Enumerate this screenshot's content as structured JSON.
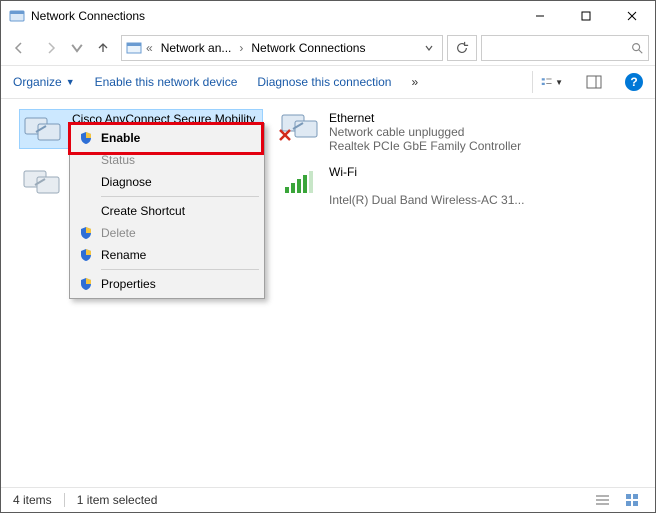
{
  "title": "Network Connections",
  "breadcrumb": {
    "lv1": "Network an...",
    "lv2": "Network Connections"
  },
  "commandbar": {
    "organize": "Organize",
    "enable_device": "Enable this network device",
    "diagnose": "Diagnose this connection"
  },
  "adapters": {
    "cisco": {
      "name": "Cisco AnyConnect Secure Mobility"
    },
    "ethernet": {
      "name": "Ethernet",
      "status": "Network cable unplugged",
      "device": "Realtek PCIe GbE Family Controller"
    },
    "wifi": {
      "name": "Wi-Fi",
      "device": "Intel(R) Dual Band Wireless-AC 31..."
    }
  },
  "context_menu": {
    "enable": "Enable",
    "status": "Status",
    "diagnose": "Diagnose",
    "create_shortcut": "Create Shortcut",
    "delete": "Delete",
    "rename": "Rename",
    "properties": "Properties"
  },
  "statusbar": {
    "count": "4 items",
    "selected": "1 item selected"
  }
}
